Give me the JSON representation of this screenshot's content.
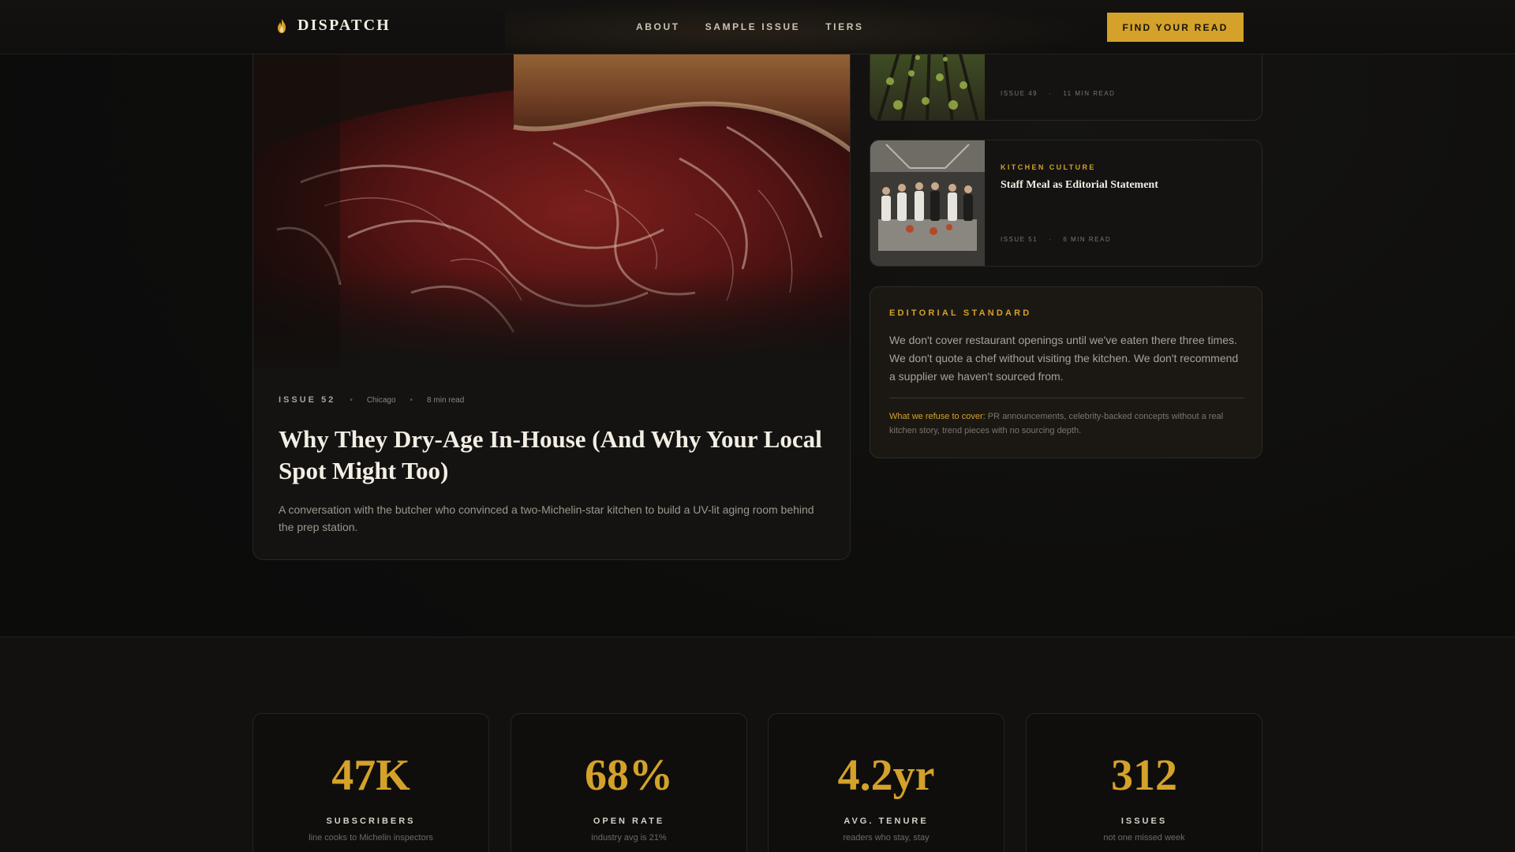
{
  "nav": {
    "brand": "DISPATCH",
    "links": [
      "ABOUT",
      "SAMPLE ISSUE",
      "TIERS"
    ],
    "cta": "FIND YOUR READ",
    "brand_icon": "flame-icon"
  },
  "feature": {
    "issue": "ISSUE 52",
    "city": "Chicago",
    "read_time": "8 min read",
    "title": "Why They Dry-Age In-House (And Why Your Local Spot Might Too)",
    "description": "A conversation with the butcher who convinced a two-Michelin-star kitchen to build a UV-lit aging room behind the prep station."
  },
  "side_articles": [
    {
      "category": "",
      "title": "",
      "issue": "ISSUE 49",
      "read_time": "11 MIN READ"
    },
    {
      "category": "KITCHEN CULTURE",
      "title": "Staff Meal as Editorial Statement",
      "issue": "ISSUE 51",
      "read_time": "6 MIN READ"
    }
  ],
  "editorial": {
    "heading": "EDITORIAL STANDARD",
    "body": "We don't cover restaurant openings until we've eaten there three times. We don't quote a chef without visiting the kitchen. We don't recommend a supplier we haven't sourced from.",
    "refuse_label": "What we refuse to cover:",
    "refuse_text": " PR announcements, celebrity-backed concepts without a real kitchen story, trend pieces with no sourcing depth."
  },
  "stats": [
    {
      "value": "47K",
      "label": "SUBSCRIBERS",
      "sub": "line cooks to Michelin inspectors"
    },
    {
      "value": "68%",
      "label": "OPEN RATE",
      "sub": "industry avg is 21%"
    },
    {
      "value": "4.2yr",
      "label": "AVG. TENURE",
      "sub": "readers who stay, stay"
    },
    {
      "value": "312",
      "label": "ISSUES",
      "sub": "not one missed week"
    }
  ],
  "colors": {
    "accent": "#d4a12a",
    "background": "#0c0c0b",
    "card": "#141312"
  }
}
